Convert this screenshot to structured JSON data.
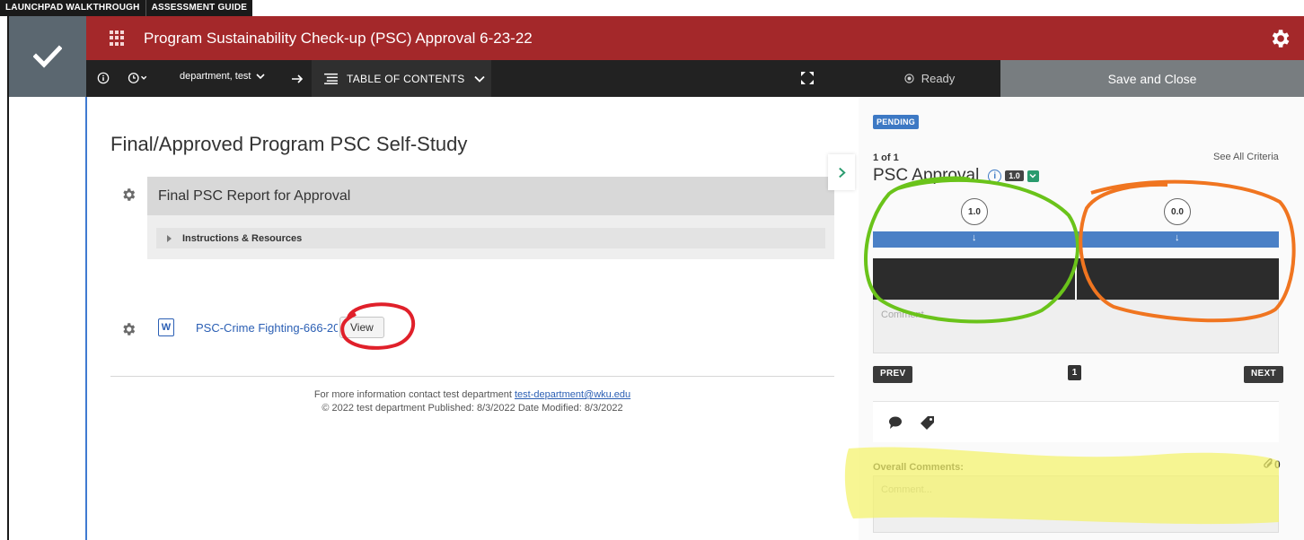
{
  "launch_strip": {
    "walkthrough": "LAUNCHPAD WALKTHROUGH",
    "guide": "ASSESSMENT GUIDE"
  },
  "header": {
    "title": "Program Sustainability Check-up (PSC) Approval 6-23-22"
  },
  "toolbar": {
    "department": "department, test",
    "toc": "TABLE OF CONTENTS",
    "status": "Ready",
    "save_close": "Save and Close"
  },
  "main": {
    "page_title": "Final/Approved Program PSC Self-Study",
    "section_title": "Final PSC Report for Approval",
    "instructions": "Instructions & Resources",
    "file_name": "PSC-Crime Fighting-666-2022",
    "view_button": "View",
    "footer_line1": "For more information contact test department",
    "footer_email": "test-department@wku.edu",
    "footer_line2": "© 2022 test department Published: 8/3/2022 Date Modified: 8/3/2022"
  },
  "right_panel": {
    "status_badge": "PENDING",
    "counter": "1 of 1",
    "see_all": "See All Criteria",
    "criterion_title": "PSC Approval",
    "criterion_score": "1.0",
    "levels": [
      {
        "score": "1.0"
      },
      {
        "score": "0.0"
      }
    ],
    "comment_placeholder": "Comment...",
    "prev": "PREV",
    "next": "NEXT",
    "page": "1",
    "overall_label": "Overall Comments:",
    "attachments_count": "0",
    "overall_placeholder": "Comment..."
  },
  "colors": {
    "header_red": "#a4282a",
    "toolbar_dark": "#222222",
    "accent_blue": "#4a80c6",
    "accent_green": "#2a9b6e",
    "annotation_red": "#e0202a",
    "annotation_green": "#6ac31a",
    "annotation_orange": "#f07520",
    "annotation_yellow": "#f4f36a"
  }
}
